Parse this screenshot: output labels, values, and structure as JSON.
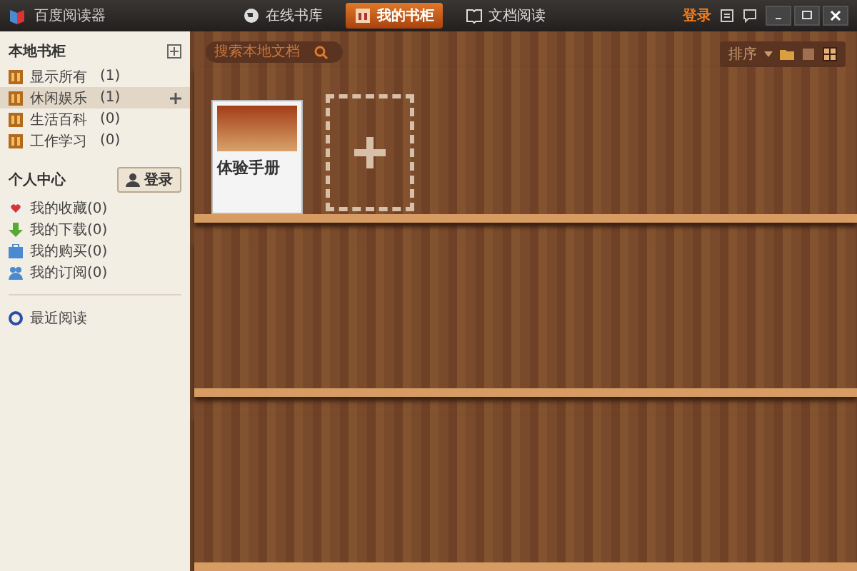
{
  "window": {
    "title": "百度阅读器",
    "login": "登录"
  },
  "tabs": [
    {
      "label": "在线书库",
      "selected": false
    },
    {
      "label": "我的书柜",
      "selected": true
    },
    {
      "label": "文档阅读",
      "selected": false
    }
  ],
  "sidebar": {
    "local_title": "本地书柜",
    "local_items": [
      {
        "label": "显示所有",
        "count": "(1)",
        "selected": false
      },
      {
        "label": "休闲娱乐",
        "count": "(1)",
        "selected": true
      },
      {
        "label": "生活百科",
        "count": "(0)",
        "selected": false
      },
      {
        "label": "工作学习",
        "count": "(0)",
        "selected": false
      }
    ],
    "personal_title": "个人中心",
    "login_button": "登录",
    "personal_items": [
      {
        "label": "我的收藏(0)",
        "kind": "heart"
      },
      {
        "label": "我的下载(0)",
        "kind": "download"
      },
      {
        "label": "我的购买(0)",
        "kind": "bag"
      },
      {
        "label": "我的订阅(0)",
        "kind": "people"
      }
    ],
    "recent": "最近阅读"
  },
  "search": {
    "placeholder": "搜索本地文档"
  },
  "toolbar": {
    "sort": "排序"
  },
  "books": [
    {
      "title": "体验手册"
    }
  ]
}
